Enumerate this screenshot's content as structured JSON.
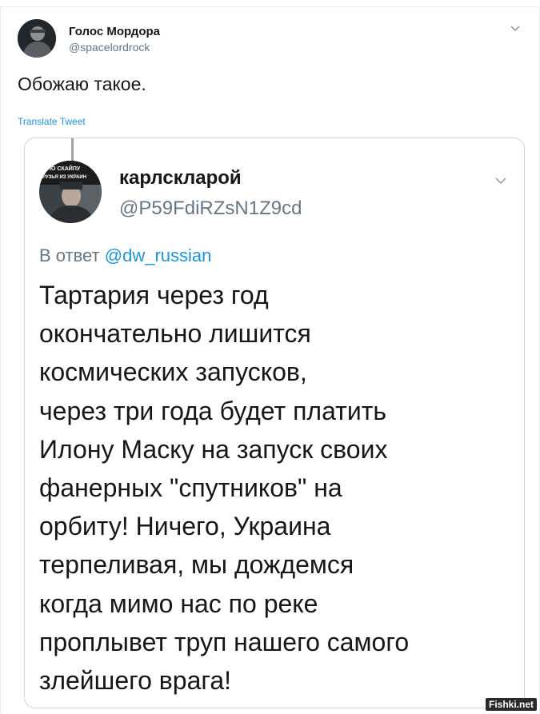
{
  "tweet": {
    "author_name": "Голос Мордора",
    "author_handle": "@spacelordrock",
    "text": "Обожаю такое.",
    "translate_label": "Translate Tweet"
  },
  "quoted": {
    "author_name": "карлскларой",
    "author_handle": "@P59FdiRZsN1Z9cd",
    "reply_prefix": "В ответ",
    "reply_mention": "@dw_russian",
    "avatar_caption_1": "ПО СКАЙПУ",
    "avatar_caption_2": "РУЗЬЯ ИЗ УКРАИН",
    "lines": [
      "Тартария через год",
      "окончательно лишится",
      "космических запусков,",
      "через три года будет платить",
      "Илону Маску на запуск своих",
      "фанерных \"спутников\" на",
      "орбиту! Ничего, Украина",
      "терпеливая, мы дождемся",
      "когда мимо нас по реке",
      "проплывет труп нашего самого",
      "злейшего врага!"
    ]
  },
  "watermark": "Fishki.net",
  "colors": {
    "link": "#1b95e0",
    "secondary_text": "#657786",
    "primary_text": "#14171a",
    "border": "#ccd6dd"
  }
}
